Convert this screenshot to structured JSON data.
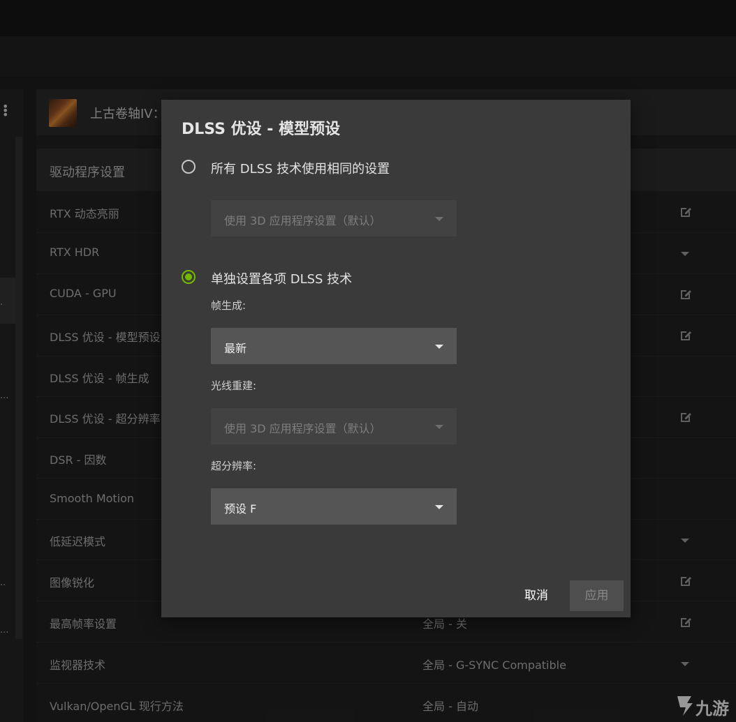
{
  "game": {
    "title": "上古卷轴IV："
  },
  "section": {
    "title": "驱动程序设置"
  },
  "rows": [
    {
      "label": "RTX 动态亮丽",
      "value": "",
      "action_icon": "edit-icon"
    },
    {
      "label": "RTX HDR",
      "value": "",
      "action_icon": "chevron-down-icon"
    },
    {
      "label": "CUDA - GPU",
      "value": "",
      "action_icon": "edit-icon"
    },
    {
      "label": "DLSS 优设 - 模型预设",
      "value": "",
      "action_icon": "edit-icon"
    },
    {
      "label": "DLSS 优设 - 帧生成",
      "value": "",
      "action_icon": ""
    },
    {
      "label": "DLSS 优设 - 超分辨率",
      "value": "",
      "action_icon": "edit-icon"
    },
    {
      "label": "DSR - 因数",
      "value": "",
      "action_icon": ""
    },
    {
      "label": "Smooth Motion",
      "value": "",
      "action_icon": ""
    },
    {
      "label": "低延迟模式",
      "value": "",
      "action_icon": "chevron-down-icon"
    },
    {
      "label": "图像锐化",
      "value": "",
      "action_icon": "edit-icon"
    },
    {
      "label": "最高帧率设置",
      "value": "全局 - 关",
      "action_icon": "edit-icon"
    },
    {
      "label": "监视器技术",
      "value": "全局 - G-SYNC Compatible",
      "action_icon": "chevron-down-icon"
    },
    {
      "label": "Vulkan/OpenGL 现行方法",
      "value": "全局 - 自动",
      "action_icon": ""
    }
  ],
  "dialog": {
    "title": "DLSS 优设 - 模型预设",
    "option_all": {
      "label": "所有 DLSS 技术使用相同的设置",
      "selected": false,
      "dropdown": "使用 3D 应用程序设置（默认）"
    },
    "option_each": {
      "label": "单独设置各项 DLSS 技术",
      "selected": true
    },
    "frame_gen": {
      "label": "帧生成:",
      "value": "最新"
    },
    "ray_recon": {
      "label": "光线重建:",
      "value": "使用 3D 应用程序设置（默认）"
    },
    "super_res": {
      "label": "超分辨率:",
      "value": "预设 F"
    },
    "cancel_label": "取消",
    "apply_label": "应用"
  },
  "watermark": {
    "text": "九游"
  },
  "colors": {
    "accent": "#76b900",
    "dialog_bg": "#3a3a3a",
    "page_bg": "#1b1b1b"
  }
}
